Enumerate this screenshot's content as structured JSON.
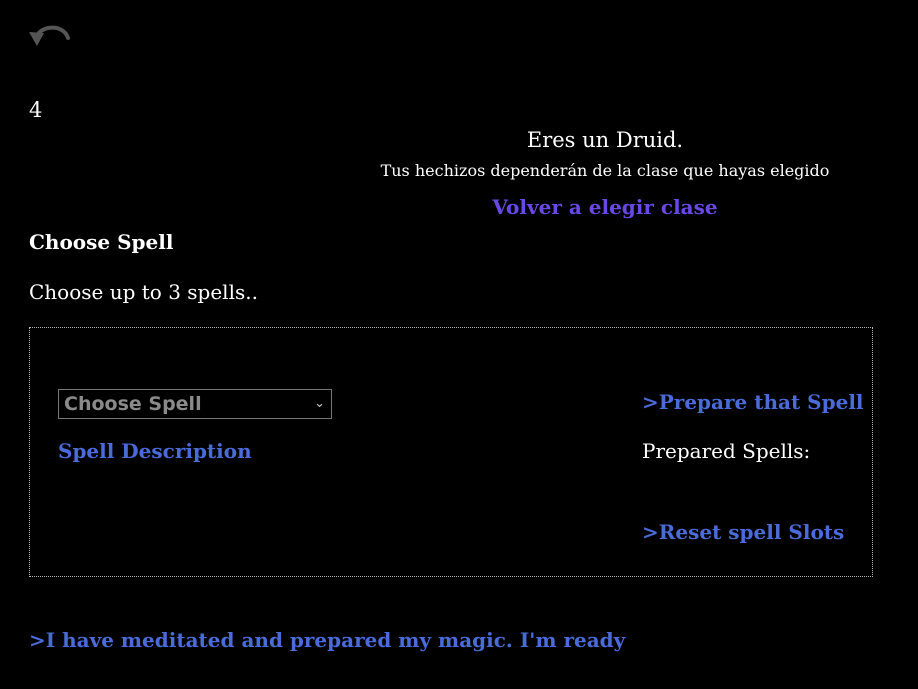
{
  "toolbar": {
    "undo_icon": "undo-arrow-icon"
  },
  "counter": "4",
  "class_info": {
    "title": "Eres un Druid.",
    "note": "Tus hechizos dependerán de la clase que hayas elegido",
    "rechoose_label": "Volver a elegir clase"
  },
  "choose_section": {
    "title": "Choose Spell",
    "subtitle": "Choose up to 3 spells..",
    "select_value": "Choose Spell",
    "description_label": "Spell Description",
    "prepare_label": ">Prepare that Spell",
    "prepared_label": "Prepared Spells:",
    "reset_label": ">Reset spell Slots"
  },
  "ready_label": ">I have meditated and prepared my magic. I'm ready",
  "colors": {
    "background": "#000000",
    "text": "#ffffff",
    "link": "#4a6bd8",
    "accent_link": "#6a48e6",
    "icon": "#555555"
  }
}
